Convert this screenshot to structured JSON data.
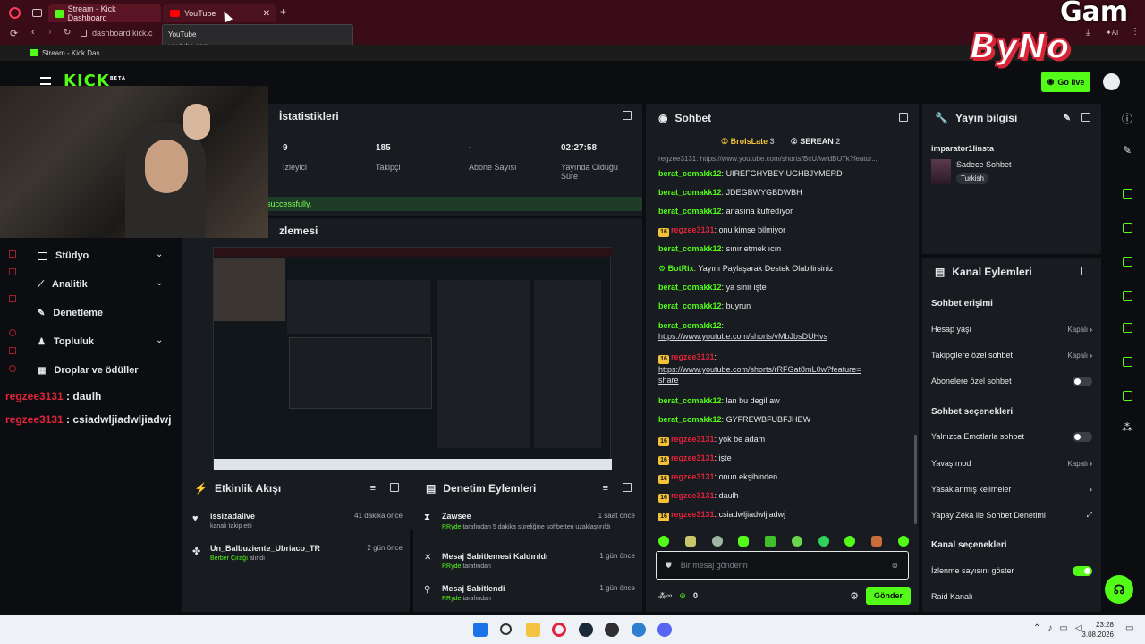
{
  "browser": {
    "tabs": [
      {
        "label": "Stream - Kick Dashboard"
      },
      {
        "label": "YouTube"
      }
    ],
    "url": "dashboard.kick.c",
    "tooltip": {
      "title": "YouTube",
      "host": "youtube.com"
    },
    "bookmark": "Stream - Kick Das..."
  },
  "overlay_text": "Gam",
  "overlay_logo": "ByNo",
  "header": {
    "logo": "KICK",
    "logo_sup": "BETA",
    "go_live": "Go live"
  },
  "sidebar": {
    "items": [
      {
        "label": "Stüdyo"
      },
      {
        "label": "Analitik"
      },
      {
        "label": "Denetleme"
      },
      {
        "label": "Topluluk"
      },
      {
        "label": "Droplar ve ödüller"
      }
    ]
  },
  "overlay_chat": [
    {
      "user": "regzee3131",
      "text": " : daulh"
    },
    {
      "user": "regzee3131",
      "text": " : csiadwljiadwljiadwj"
    }
  ],
  "stats": {
    "title": "İstatistikleri",
    "items": [
      {
        "value": "9",
        "label": "İzleyici"
      },
      {
        "value": "185",
        "label": "Takipçi"
      },
      {
        "value": "-",
        "label": "Abone Sayısı"
      },
      {
        "value": "02:27:58",
        "label": "Yayında Olduğu Süre"
      }
    ],
    "notice": "successfully."
  },
  "preview": {
    "title": "zlemesi"
  },
  "activity": {
    "title": "Etkinlik Akışı",
    "items": [
      {
        "name": "issizadalive",
        "sub": "kanalı takip etti",
        "time": "41 dakika önce"
      },
      {
        "name": "Un_Balbuziente_Ubriaco_TR",
        "highlight": "Berber Çırağı",
        "sub": " alındı",
        "time": "2 gün önce"
      }
    ]
  },
  "moderation": {
    "title": "Denetim Eylemleri",
    "items": [
      {
        "name": "Zawsee",
        "actor": "RRyde",
        "sub": " tarafından 5 dakika süreliğine sohbetten uzaklaştırıldı",
        "time": "1 saat önce"
      },
      {
        "name": "Mesaj Sabitlemesi Kaldırıldı",
        "actor": "RRyde",
        "sub": " tarafından",
        "time": "1 gün önce"
      },
      {
        "name": "Mesaj Sabitlendi",
        "actor": "RRyde",
        "sub": " tarafından",
        "time": "1 gün önce"
      }
    ]
  },
  "chat": {
    "title": "Sohbet",
    "top_users": [
      {
        "name": "BrolsLate",
        "count": "3"
      },
      {
        "name": "SEREAN",
        "count": "2"
      }
    ],
    "reply": "regzee3131: https://www.youtube.com/shorts/BcUAwidBU7k?featur...",
    "messages": [
      {
        "user": "berat_comakk12",
        "text": "UIREFGHYBEYIUGHBJYMERD"
      },
      {
        "user": "berat_comakk12",
        "text": "JDEGBWYGBDWBH"
      },
      {
        "user": "berat_comakk12",
        "text": "anasına kufredıyor"
      },
      {
        "badge": "16",
        "user": "regzee3131",
        "text": "onu kimse bilmiyor"
      },
      {
        "user": "berat_comakk12",
        "text": "sınır etmek ıcın"
      },
      {
        "user": "BotRix",
        "text": "Yayını Paylaşarak Destek Olabilirsiniz"
      },
      {
        "user": "berat_comakk12",
        "text": "ya sinir işte"
      },
      {
        "user": "berat_comakk12",
        "text": "buyrun"
      },
      {
        "user": "berat_comakk12",
        "text": "",
        "link": "https://www.youtube.com/shorts/vMbJbsDUHvs"
      },
      {
        "badge": "16",
        "user": "regzee3131",
        "text": "",
        "link": "https://www.youtube.com/shorts/rRFGat8mL0w?feature=share"
      },
      {
        "user": "berat_comakk12",
        "text": "lan bu degil aw"
      },
      {
        "user": "berat_comakk12",
        "text": "GYFREWBFUBFJHEW"
      },
      {
        "badge": "16",
        "user": "regzee3131",
        "text": "yok be adam"
      },
      {
        "badge": "16",
        "user": "regzee3131",
        "text": "işte"
      },
      {
        "badge": "16",
        "user": "regzee3131",
        "text": "onun ekşibinden"
      },
      {
        "badge": "16",
        "user": "regzee3131",
        "text": "daulh"
      },
      {
        "badge": "16",
        "user": "regzee3131",
        "text": "csiadwljiadwljiadwj"
      }
    ],
    "input_placeholder": "Bir mesaj gönderin",
    "points": "0",
    "send": "Gönder"
  },
  "stream_info": {
    "title": "Yayın bilgisi",
    "stream_title": "imparator1linsta",
    "mode": "Sadece Sohbet",
    "language": "Turkish"
  },
  "channel_actions": {
    "title": "Kanal Eylemleri",
    "sections": [
      {
        "heading": "Sohbet erişimi"
      },
      {
        "heading": "Sohbet seçenekleri"
      },
      {
        "heading": "Kanal seçenekleri"
      }
    ],
    "rows": [
      {
        "label": "Hesap yaşı",
        "value": "Kapalı"
      },
      {
        "label": "Takipçilere özel sohbet",
        "value": "Kapalı"
      },
      {
        "label": "Abonelere özel sohbet",
        "value": ""
      },
      {
        "label": "Yalnızca Emotlarla sohbet",
        "value": ""
      },
      {
        "label": "Yavaş mod",
        "value": "Kapalı"
      },
      {
        "label": "Yasaklanmış kelimeler",
        "value": ""
      },
      {
        "label": "Yapay Zeka ile Sohbet Denetimi",
        "value": ""
      },
      {
        "label": "İzlenme sayısını göster",
        "value": ""
      },
      {
        "label": "Raid Kanalı",
        "value": ""
      }
    ]
  },
  "taskbar": {
    "time": "23:28",
    "date": "3.08.2026"
  },
  "colors": {
    "accent": "#53fc18",
    "browser": "#3a0c17",
    "panel": "#181b1f"
  }
}
